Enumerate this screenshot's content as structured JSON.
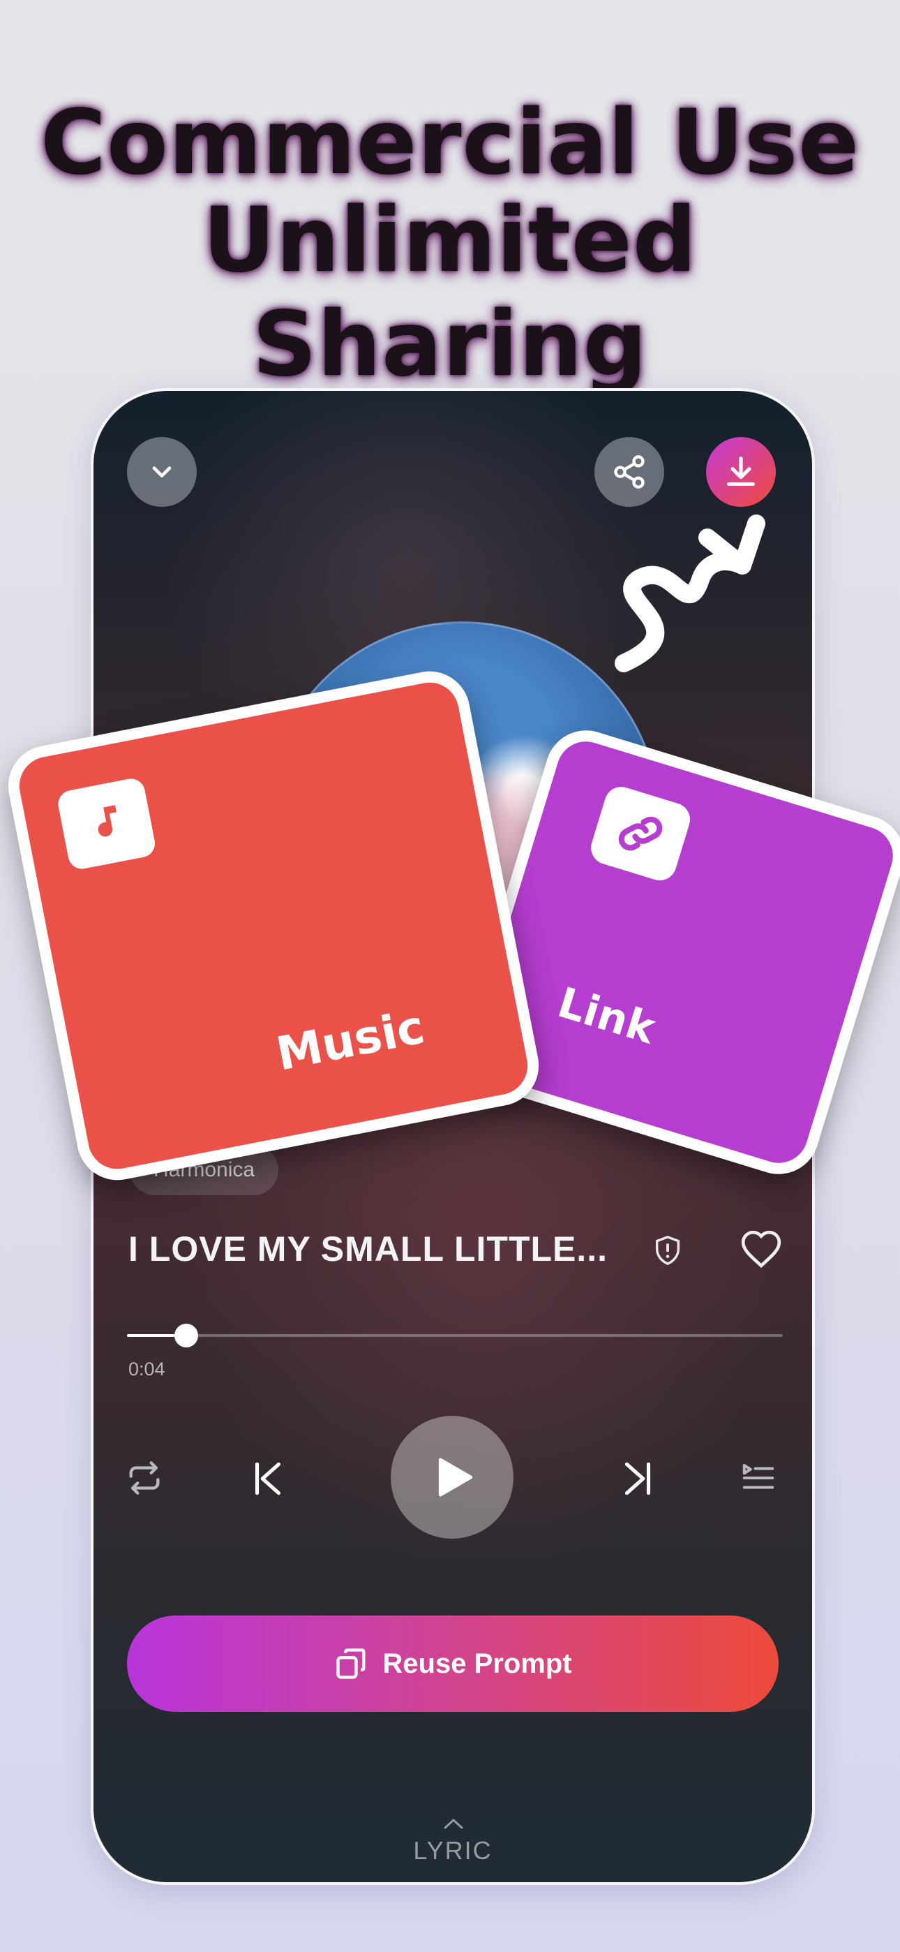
{
  "headline": {
    "line1": "Commercial Use",
    "line2": "Unlimited Sharing"
  },
  "player": {
    "artist_chip": "Harmonica",
    "song_title": "I LOVE MY SMALL LITTLE...",
    "elapsed": "0:04",
    "progress": 0.09,
    "reuse_prompt_label": "Reuse Prompt",
    "lyric_label": "LYRIC"
  },
  "cards": {
    "music_label": "Music",
    "link_label": "Link"
  },
  "colors": {
    "accent_purple": "#b935db",
    "accent_red": "#ee4a3b",
    "music_card": "#ea5148",
    "link_card": "#b53dcf"
  },
  "icons": [
    "chevron-down-icon",
    "share-icon",
    "download-icon",
    "shield-alert-icon",
    "heart-icon",
    "repeat-icon",
    "skip-previous-icon",
    "play-icon",
    "skip-next-icon",
    "queue-icon",
    "copy-icon",
    "chevron-up-icon",
    "music-folder-icon",
    "link-icon"
  ]
}
